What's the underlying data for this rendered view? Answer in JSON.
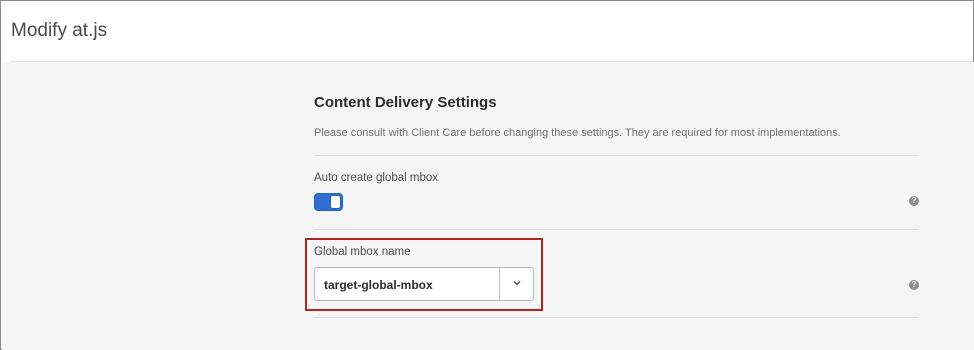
{
  "header": {
    "title": "Modify at.js"
  },
  "section": {
    "title": "Content Delivery Settings",
    "description": "Please consult with Client Care before changing these settings. They are required for most implementations."
  },
  "fields": {
    "auto_create": {
      "label": "Auto create global mbox",
      "enabled": true,
      "help": "?"
    },
    "global_mbox": {
      "label": "Global mbox name",
      "value": "target-global-mbox",
      "help": "?"
    }
  },
  "colors": {
    "accent": "#2f6fd1",
    "highlight": "#b3241f"
  },
  "icons": {
    "help": "help-icon",
    "dropdown": "chevron-down-icon"
  }
}
